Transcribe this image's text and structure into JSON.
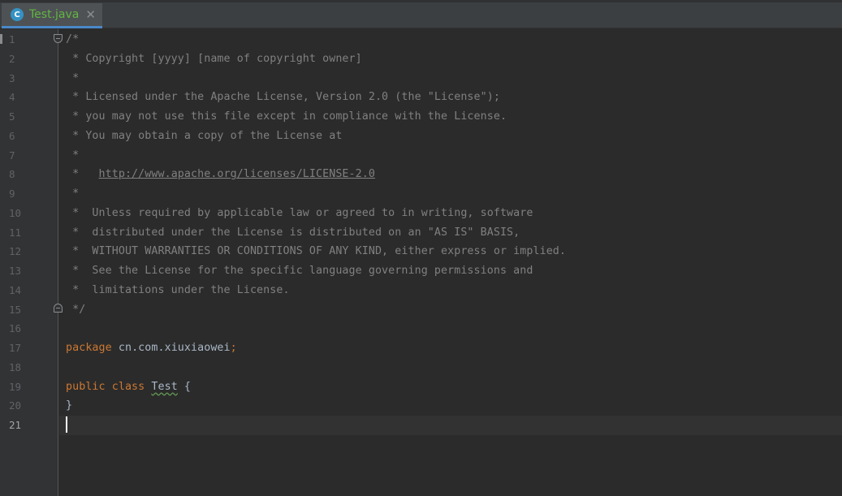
{
  "tab": {
    "icon": "class-icon",
    "icon_letter": "C",
    "title": "Test.java",
    "close_symbol": "✕"
  },
  "editor": {
    "line_numbers": [
      "1",
      "2",
      "3",
      "4",
      "5",
      "6",
      "7",
      "8",
      "9",
      "10",
      "11",
      "12",
      "13",
      "14",
      "15",
      "16",
      "17",
      "18",
      "19",
      "20",
      "21"
    ],
    "current_line": 21,
    "lines": {
      "l1": "/*",
      "l2": " * Copyright [yyyy] [name of copyright owner]",
      "l3": " *",
      "l4": " * Licensed under the Apache License, Version 2.0 (the \"License\");",
      "l5": " * you may not use this file except in compliance with the License.",
      "l6": " * You may obtain a copy of the License at",
      "l7": " *",
      "l8_prefix": " *   ",
      "l8_link": "http://www.apache.org/licenses/LICENSE-2.0",
      "l9": " *",
      "l10": " *  Unless required by applicable law or agreed to in writing, software",
      "l11": " *  distributed under the License is distributed on an \"AS IS\" BASIS,",
      "l12": " *  WITHOUT WARRANTIES OR CONDITIONS OF ANY KIND, either express or implied.",
      "l13": " *  See the License for the specific language governing permissions and",
      "l14": " *  limitations under the License.",
      "l15": " */",
      "l17_kw": "package",
      "l17_name": " cn.com.xiuxiaowei",
      "l17_semi": ";",
      "l19_kw": "public class",
      "l19_space": " ",
      "l19_name": "Test",
      "l19_brace": " {",
      "l20": "}"
    }
  },
  "colors": {
    "background": "#2b2b2b",
    "gutter": "#313335",
    "comment": "#808080",
    "keyword": "#cc7832",
    "text": "#a9b7c6",
    "tab_title": "#62b543"
  }
}
